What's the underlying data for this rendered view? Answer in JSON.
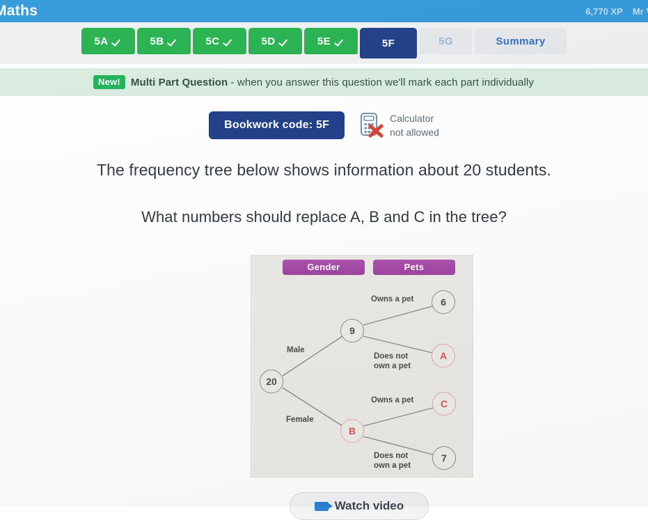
{
  "topbar": {
    "title": "Maths",
    "xp": "6,770 XP",
    "user": "Mr V"
  },
  "tabs": [
    {
      "label": "5A",
      "state": "done",
      "icon": "check-icon"
    },
    {
      "label": "5B",
      "state": "done",
      "icon": "check-icon"
    },
    {
      "label": "5C",
      "state": "done",
      "icon": "check-icon"
    },
    {
      "label": "5D",
      "state": "done",
      "icon": "check-icon"
    },
    {
      "label": "5E",
      "state": "done",
      "icon": "check-icon"
    },
    {
      "label": "5F",
      "state": "active",
      "icon": ""
    },
    {
      "label": "5G",
      "state": "locked",
      "icon": ""
    },
    {
      "label": "Summary",
      "state": "summary",
      "icon": ""
    }
  ],
  "banner": {
    "pill": "New!",
    "bold_text": "Multi Part Question",
    "rest_text": " - when you answer this question we'll mark each part individually"
  },
  "bookwork": {
    "code_label": "Bookwork code: 5F",
    "calculator_icon": "calculator-not-allowed-icon",
    "calculator_line1": "Calculator",
    "calculator_line2": "not allowed"
  },
  "question": {
    "line1": "The frequency tree below shows information about 20 students.",
    "line2": "What numbers should replace A, B and C in the tree?"
  },
  "tree": {
    "headers": [
      {
        "id": "gender",
        "label": "Gender"
      },
      {
        "id": "pets",
        "label": "Pets"
      }
    ],
    "nodes": [
      {
        "id": "root",
        "label": "20",
        "style": "grey"
      },
      {
        "id": "male",
        "label": "9",
        "style": "grey"
      },
      {
        "id": "female",
        "label": "B",
        "style": "red"
      },
      {
        "id": "male-pet",
        "label": "6",
        "style": "grey"
      },
      {
        "id": "male-nopet",
        "label": "A",
        "style": "red"
      },
      {
        "id": "female-pet",
        "label": "C",
        "style": "red"
      },
      {
        "id": "female-nopet",
        "label": "7",
        "style": "grey"
      }
    ],
    "edge_labels": [
      {
        "id": "male",
        "text": "Male"
      },
      {
        "id": "female",
        "text": "Female"
      },
      {
        "id": "male-pet",
        "text": "Owns a pet"
      },
      {
        "id": "male-nopet",
        "text": "Does not\nown a pet"
      },
      {
        "id": "female-pet",
        "text": "Owns a pet"
      },
      {
        "id": "female-nopet",
        "text": "Does not\nown a pet"
      }
    ]
  },
  "footer": {
    "watch_label": "Watch video",
    "watch_icon": "video-camera-icon"
  },
  "colors": {
    "header_blue": "#2e96d8",
    "tab_done_green": "#22b14c",
    "tab_active_navy": "#1b3a86",
    "banner_green": "#d9ece0",
    "purple_header": "#9c3f9f",
    "red_node": "#d9534f"
  }
}
